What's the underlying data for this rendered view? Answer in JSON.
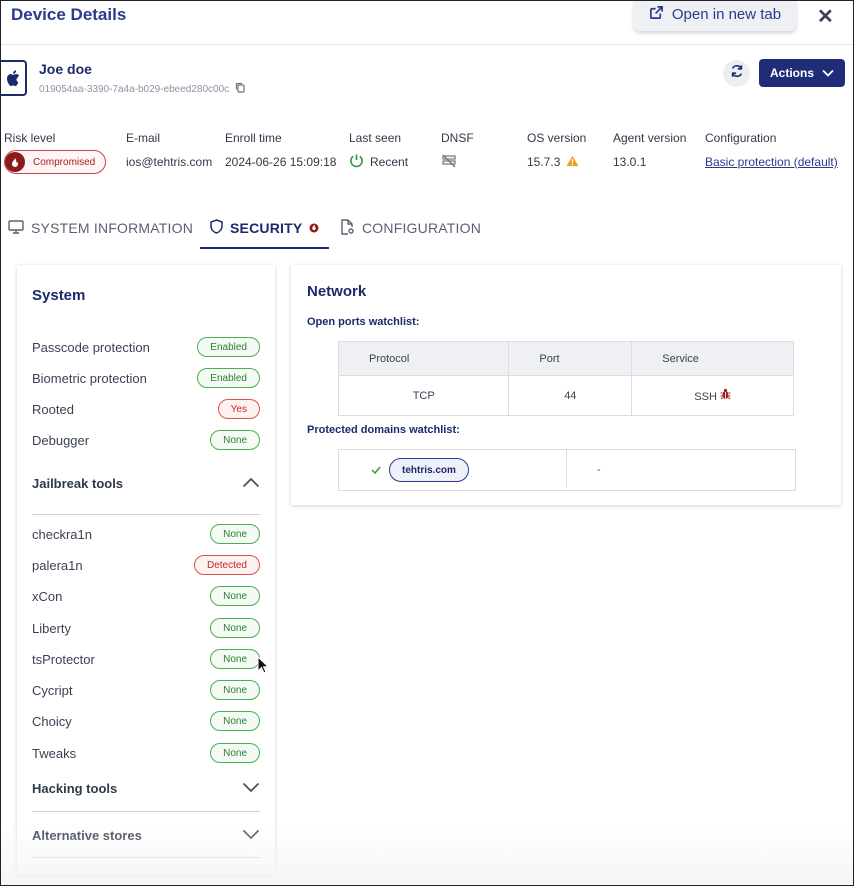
{
  "header": {
    "title": "Device Details",
    "open_label": "Open in new tab"
  },
  "device": {
    "name": "Joe doe",
    "id": "019054aa-3390-7a4a-b029-ebeed280c00c"
  },
  "actions_label": "Actions",
  "info": {
    "risk": {
      "label": "Risk level",
      "value": "Compromised"
    },
    "email": {
      "label": "E-mail",
      "value": "ios@tehtris.com"
    },
    "enroll": {
      "label": "Enroll time",
      "value": "2024-06-26 15:09:18"
    },
    "last_seen": {
      "label": "Last seen",
      "value": "Recent"
    },
    "dnsf": {
      "label": "DNSF"
    },
    "os": {
      "label": "OS version",
      "value": "15.7.3"
    },
    "agent": {
      "label": "Agent version",
      "value": "13.0.1"
    },
    "config": {
      "label": "Configuration",
      "value": "Basic protection (default)"
    }
  },
  "tabs": [
    {
      "label": "SYSTEM INFORMATION"
    },
    {
      "label": "SECURITY"
    },
    {
      "label": "CONFIGURATION"
    }
  ],
  "system": {
    "title": "System",
    "items": [
      {
        "label": "Passcode protection",
        "status": "Enabled"
      },
      {
        "label": "Biometric protection",
        "status": "Enabled"
      },
      {
        "label": "Rooted",
        "status": "Yes"
      },
      {
        "label": "Debugger",
        "status": "None"
      }
    ],
    "jailbreak": {
      "title": "Jailbreak tools",
      "items": [
        {
          "label": "checkra1n",
          "status": "None"
        },
        {
          "label": "palera1n",
          "status": "Detected"
        },
        {
          "label": "xCon",
          "status": "None"
        },
        {
          "label": "Liberty",
          "status": "None"
        },
        {
          "label": "tsProtector",
          "status": "None"
        },
        {
          "label": "Cycript",
          "status": "None"
        },
        {
          "label": "Choicy",
          "status": "None"
        },
        {
          "label": "Tweaks",
          "status": "None"
        }
      ]
    },
    "hacking": {
      "title": "Hacking tools"
    },
    "alt_stores": {
      "title": "Alternative stores"
    }
  },
  "network": {
    "title": "Network",
    "ports_label": "Open ports watchlist:",
    "ports_headers": [
      "Protocol",
      "Port",
      "Service"
    ],
    "ports_rows": [
      {
        "protocol": "TCP",
        "port": "44",
        "service": "SSH"
      }
    ],
    "domains_label": "Protected domains watchlist:",
    "domains": [
      {
        "domain": "tehtris.com",
        "value": "-"
      }
    ]
  },
  "colors": {
    "primary": "#1b2a6b",
    "danger": "#c62828",
    "success": "#2e7d32",
    "warning": "#f0a020"
  }
}
